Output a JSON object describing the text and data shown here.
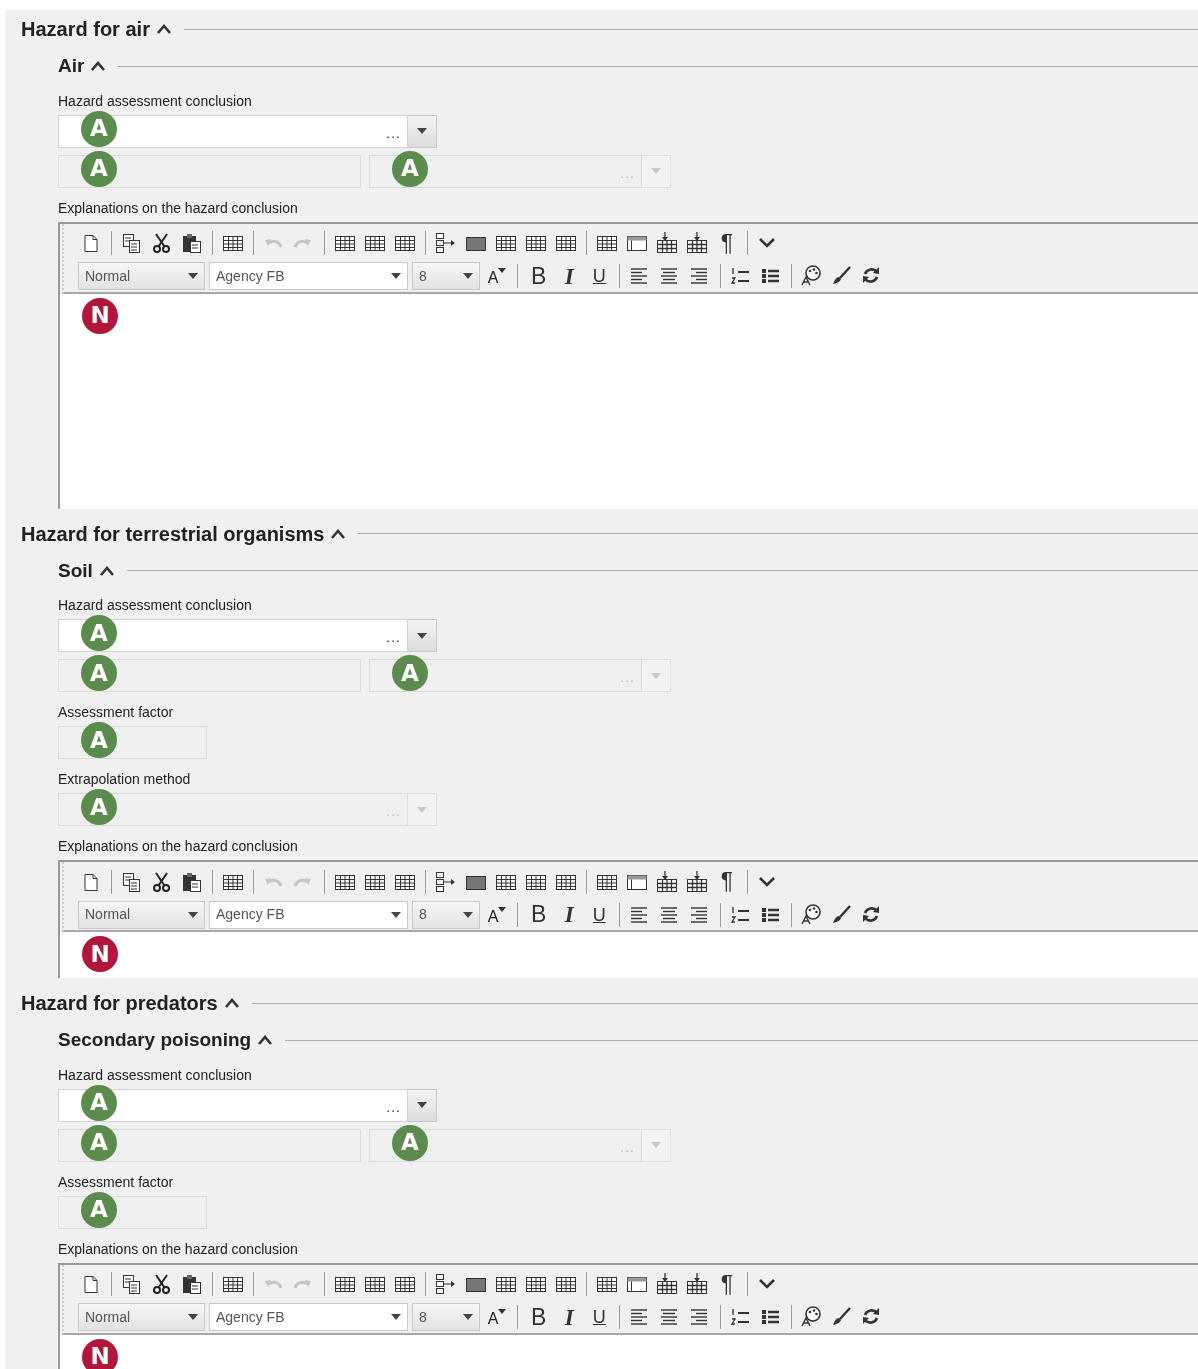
{
  "sections": [
    {
      "title": "Hazard for air",
      "expanded": true,
      "subsections": [
        {
          "title": "Air",
          "expanded": true,
          "fields": [
            {
              "label": "Hazard assessment conclusion",
              "controls": [
                {
                  "kind": "picklist",
                  "disabled": false,
                  "more": "...",
                  "badge": {
                    "text": "A",
                    "color": "#5b8c4e"
                  }
                }
              ]
            },
            {
              "controls": [
                {
                  "kind": "text",
                  "disabled": true,
                  "badge": {
                    "text": "A",
                    "color": "#5b8c4e"
                  }
                },
                {
                  "kind": "picklist",
                  "disabled": true,
                  "more": "...",
                  "badge": {
                    "text": "A",
                    "color": "#5b8c4e"
                  }
                }
              ]
            },
            {
              "label": "Explanations on the hazard conclusion",
              "controls": [
                {
                  "kind": "editor",
                  "clipped": false,
                  "style": "Normal",
                  "font": "Agency FB",
                  "size": "8",
                  "grow": "A",
                  "format": [
                    "B",
                    "I",
                    "U"
                  ],
                  "pilcrow": "¶",
                  "badge": {
                    "text": "N",
                    "color": "#b0173a"
                  }
                }
              ]
            }
          ]
        }
      ]
    },
    {
      "title": "Hazard for terrestrial organisms",
      "expanded": true,
      "subsections": [
        {
          "title": "Soil",
          "expanded": true,
          "fields": [
            {
              "label": "Hazard assessment conclusion",
              "controls": [
                {
                  "kind": "picklist",
                  "disabled": false,
                  "more": "...",
                  "badge": {
                    "text": "A",
                    "color": "#5b8c4e"
                  }
                }
              ]
            },
            {
              "controls": [
                {
                  "kind": "text",
                  "disabled": true,
                  "badge": {
                    "text": "A",
                    "color": "#5b8c4e"
                  }
                },
                {
                  "kind": "picklist",
                  "disabled": true,
                  "more": "...",
                  "badge": {
                    "text": "A",
                    "color": "#5b8c4e"
                  }
                }
              ]
            },
            {
              "label": "Assessment factor",
              "controls": [
                {
                  "kind": "text",
                  "disabled": true,
                  "badge": {
                    "text": "A",
                    "color": "#5b8c4e"
                  }
                }
              ]
            },
            {
              "label": "Extrapolation method",
              "controls": [
                {
                  "kind": "picklist",
                  "disabled": true,
                  "more": "...",
                  "badge": {
                    "text": "A",
                    "color": "#5b8c4e"
                  }
                }
              ]
            },
            {
              "label": "Explanations on the hazard conclusion",
              "controls": [
                {
                  "kind": "editor",
                  "clipped": true,
                  "style": "Normal",
                  "font": "Agency FB",
                  "size": "8",
                  "grow": "A",
                  "format": [
                    "B",
                    "I",
                    "U"
                  ],
                  "pilcrow": "¶",
                  "badge": {
                    "text": "N",
                    "color": "#b0173a"
                  }
                }
              ]
            }
          ]
        }
      ]
    },
    {
      "title": "Hazard for predators",
      "expanded": true,
      "subsections": [
        {
          "title": "Secondary poisoning",
          "expanded": true,
          "fields": [
            {
              "label": "Hazard assessment conclusion",
              "controls": [
                {
                  "kind": "picklist",
                  "disabled": false,
                  "more": "...",
                  "badge": {
                    "text": "A",
                    "color": "#5b8c4e"
                  }
                }
              ]
            },
            {
              "controls": [
                {
                  "kind": "text",
                  "disabled": true,
                  "badge": {
                    "text": "A",
                    "color": "#5b8c4e"
                  }
                },
                {
                  "kind": "picklist",
                  "disabled": true,
                  "more": "...",
                  "badge": {
                    "text": "A",
                    "color": "#5b8c4e"
                  }
                }
              ]
            },
            {
              "label": "Assessment factor",
              "controls": [
                {
                  "kind": "text",
                  "disabled": true,
                  "badge": {
                    "text": "A",
                    "color": "#5b8c4e"
                  }
                }
              ]
            },
            {
              "label": "Explanations on the hazard conclusion",
              "controls": [
                {
                  "kind": "editor",
                  "clipped": true,
                  "style": "Normal",
                  "font": "Agency FB",
                  "size": "8",
                  "grow": "A",
                  "format": [
                    "B",
                    "I",
                    "U"
                  ],
                  "pilcrow": "¶",
                  "badge": {
                    "text": "N",
                    "color": "#b0173a"
                  }
                }
              ]
            }
          ]
        }
      ]
    }
  ]
}
